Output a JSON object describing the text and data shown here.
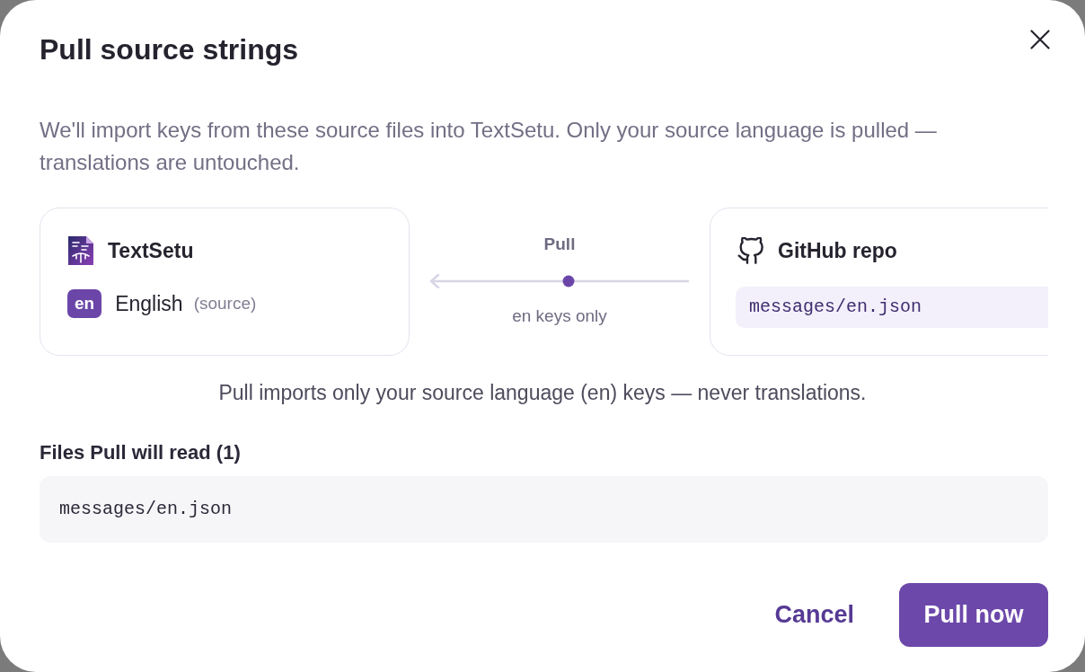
{
  "dialog": {
    "title": "Pull source strings"
  },
  "description": "We'll import keys from these source files into TextSetu. Only your source language is pulled — translations are untouched.",
  "source_card": {
    "name": "TextSetu",
    "language_code": "en",
    "language_name": "English",
    "role": "(source)"
  },
  "connector": {
    "label": "Pull",
    "caption": "en keys only"
  },
  "target_card": {
    "name": "GitHub repo",
    "file_path": "messages/en.json"
  },
  "note": "Pull imports only your source language (en) keys — never translations.",
  "files": {
    "heading": "Files Pull will read (1)",
    "items": [
      "messages/en.json"
    ]
  },
  "buttons": [
    {
      "label": "Cancel",
      "kind": "text"
    },
    {
      "label": "Pull now",
      "kind": "primary"
    }
  ]
}
